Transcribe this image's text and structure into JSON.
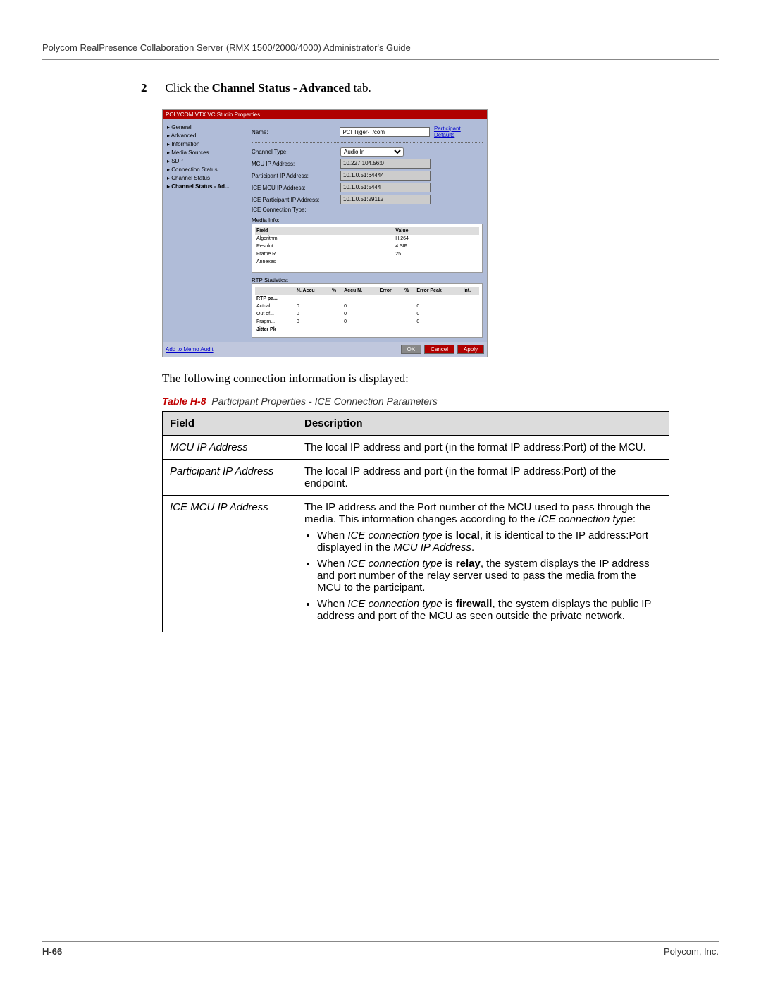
{
  "header": "Polycom RealPresence Collaboration Server (RMX 1500/2000/4000) Administrator's Guide",
  "step": {
    "num": "2",
    "pre": "Click the ",
    "bold": "Channel Status - Advanced",
    "post": " tab."
  },
  "screenshot": {
    "title": "POLYCOM VTX VC Studio Properties",
    "nav": [
      "General",
      "Advanced",
      "Information",
      "Media Sources",
      "SDP",
      "Connection Status",
      "Channel Status",
      "Channel Status - Ad..."
    ],
    "name_label": "Name:",
    "name_value": "PCI Tijger-_/com",
    "defaults_link": "Participant Defaults",
    "channel_label": "Channel Type:",
    "channel_value": "Audio In",
    "rows": [
      {
        "label": "MCU IP Address:",
        "value": "10.227.104.56:0"
      },
      {
        "label": "Participant IP Address:",
        "value": "10.1.0.51:64444"
      },
      {
        "label": "ICE MCU IP Address:",
        "value": "10.1.0.51:5444"
      },
      {
        "label": "ICE Participant IP Address:",
        "value": "10.1.0.51:29112"
      },
      {
        "label": "ICE Connection Type:",
        "value": ""
      }
    ],
    "media_title": "Media Info:",
    "media_headers": [
      "Field",
      "Value"
    ],
    "media": [
      {
        "f": "Algorithm",
        "v": "H.264"
      },
      {
        "f": "Resolut...",
        "v": "4 SIF"
      },
      {
        "f": "Frame R...",
        "v": "25"
      },
      {
        "f": "Annexes",
        "v": ""
      }
    ],
    "rtp_title": "RTP Statistics:",
    "rtp_headers": [
      "",
      "N. Accu",
      "%",
      "Accu N.",
      "Error",
      "%",
      "Error Peak",
      "Int."
    ],
    "rtp": [
      {
        "n": "RTP pa..."
      },
      {
        "n": "Actual",
        "a": "0",
        "b": "0",
        "c": "0"
      },
      {
        "n": "Out of...",
        "a": "0",
        "b": "0",
        "c": "0"
      },
      {
        "n": "Fragm...",
        "a": "0",
        "b": "0",
        "c": "0"
      },
      {
        "n": "Jitter Pk"
      }
    ],
    "mute_link": "Add to Memo Audit",
    "buttons": {
      "ok": "OK",
      "cancel": "Cancel",
      "apply": "Apply"
    }
  },
  "para": "The following connection information is displayed:",
  "caption": {
    "num": "Table H-8",
    "title": "Participant Properties - ICE Connection Parameters"
  },
  "table": {
    "headers": [
      "Field",
      "Description"
    ],
    "rows": [
      {
        "field": "MCU IP Address",
        "desc": "The local IP address and port (in the format IP address:Port) of the MCU."
      },
      {
        "field": "Participant IP Address",
        "desc": "The local IP address and port (in the format IP address:Port) of the endpoint."
      },
      {
        "field": "ICE MCU IP Address",
        "desc_intro": "The IP address and the Port number of the MCU used to pass through the media. This information changes according to the ",
        "desc_em": "ICE connection type",
        "desc_colon": ":",
        "bullets": [
          {
            "pre": "When ",
            "em1": "ICE connection type",
            "mid": " is ",
            "b": "local",
            "post1": ", it is identical to the IP address:Port displayed in the ",
            "em2": "MCU IP Address",
            "post2": "."
          },
          {
            "pre": "When ",
            "em1": "ICE connection type",
            "mid": " is ",
            "b": "relay",
            "post1": ", the system displays the IP address and port number of the relay server used to pass the media from the MCU to the participant.",
            "em2": "",
            "post2": ""
          },
          {
            "pre": "When ",
            "em1": "ICE connection type",
            "mid": " is ",
            "b": "firewall",
            "post1": ", the system displays the public IP address and port of the MCU as seen outside the private network.",
            "em2": "",
            "post2": ""
          }
        ]
      }
    ]
  },
  "footer": {
    "page": "H-66",
    "company": "Polycom, Inc."
  }
}
